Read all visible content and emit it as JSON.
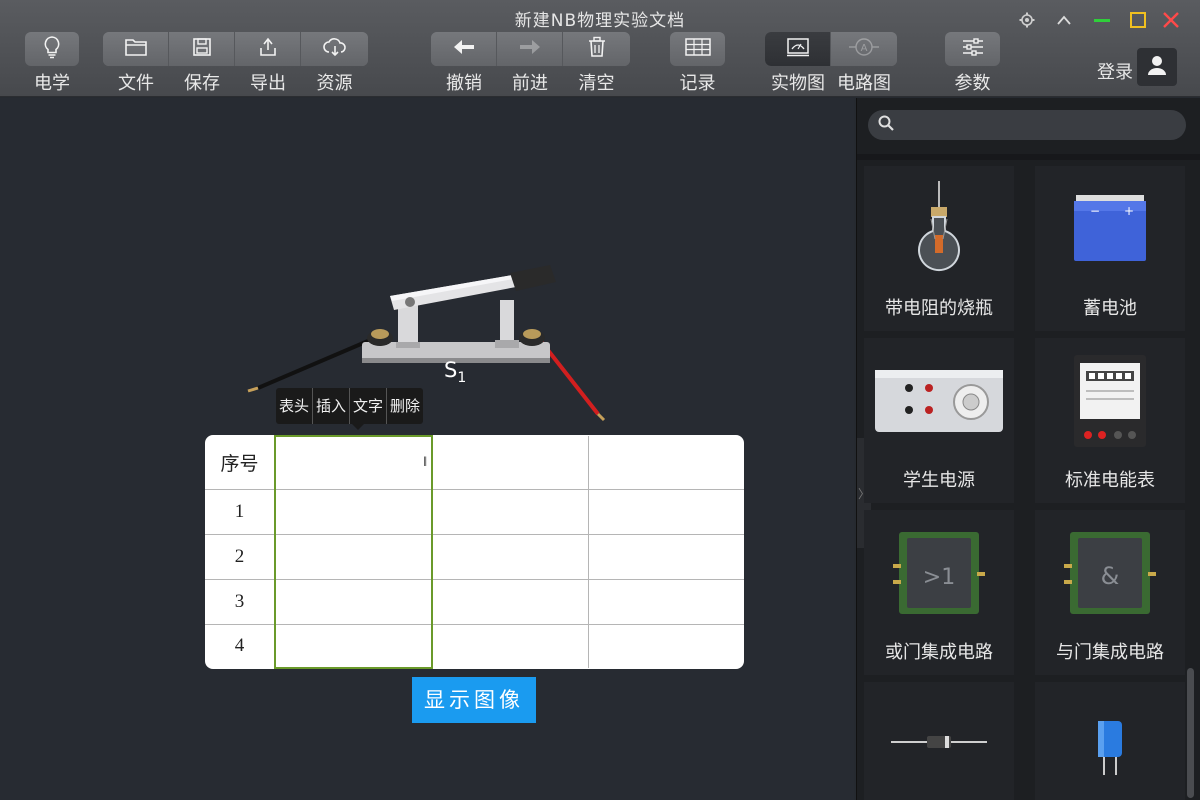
{
  "window": {
    "title": "新建NB物理实验文档"
  },
  "toolbar": {
    "subject": {
      "label": "电学"
    },
    "file": {
      "label": "文件"
    },
    "save": {
      "label": "保存"
    },
    "export": {
      "label": "导出"
    },
    "resource": {
      "label": "资源"
    },
    "undo": {
      "label": "撤销"
    },
    "redo": {
      "label": "前进"
    },
    "clear": {
      "label": "清空"
    },
    "record": {
      "label": "记录"
    },
    "physical_view": {
      "label": "实物图"
    },
    "circuit_view": {
      "label": "电路图"
    },
    "params": {
      "label": "参数"
    },
    "login": {
      "label": "登录"
    }
  },
  "canvas": {
    "switch_label": "S",
    "switch_subscript": "1",
    "context_menu": [
      "表头",
      "插入",
      "文字",
      "删除"
    ],
    "table": {
      "header": [
        "序号",
        "",
        "",
        ""
      ],
      "rows": [
        [
          "1",
          "",
          "",
          ""
        ],
        [
          "2",
          "",
          "",
          ""
        ],
        [
          "3",
          "",
          "",
          ""
        ],
        [
          "4",
          "",
          "",
          ""
        ]
      ],
      "cursor_text": "‖"
    },
    "show_image_label": "显示图像"
  },
  "sidepanel": {
    "search": {
      "placeholder": "",
      "value": ""
    },
    "components": [
      {
        "label": "带电阻的烧瓶",
        "icon": "flask-with-resistor-icon"
      },
      {
        "label": "蓄电池",
        "icon": "battery-icon"
      },
      {
        "label": "学生电源",
        "icon": "student-power-supply-icon"
      },
      {
        "label": "标准电能表",
        "icon": "electric-meter-icon"
      },
      {
        "label": "或门集成电路",
        "icon": "or-gate-chip-icon",
        "symbol": ">1"
      },
      {
        "label": "与门集成电路",
        "icon": "and-gate-chip-icon",
        "symbol": "&"
      },
      {
        "label": "",
        "icon": "diode-icon"
      },
      {
        "label": "",
        "icon": "capacitor-icon"
      }
    ]
  },
  "colors": {
    "toolbar_bg": "#4f5155",
    "canvas_bg": "#272b32",
    "panel_bg": "#1d1f22",
    "accent_blue": "#1a9bf0",
    "selection_green": "#6a9a2a",
    "wire_red": "#d21f1f",
    "battery_blue": "#3f63d9"
  }
}
